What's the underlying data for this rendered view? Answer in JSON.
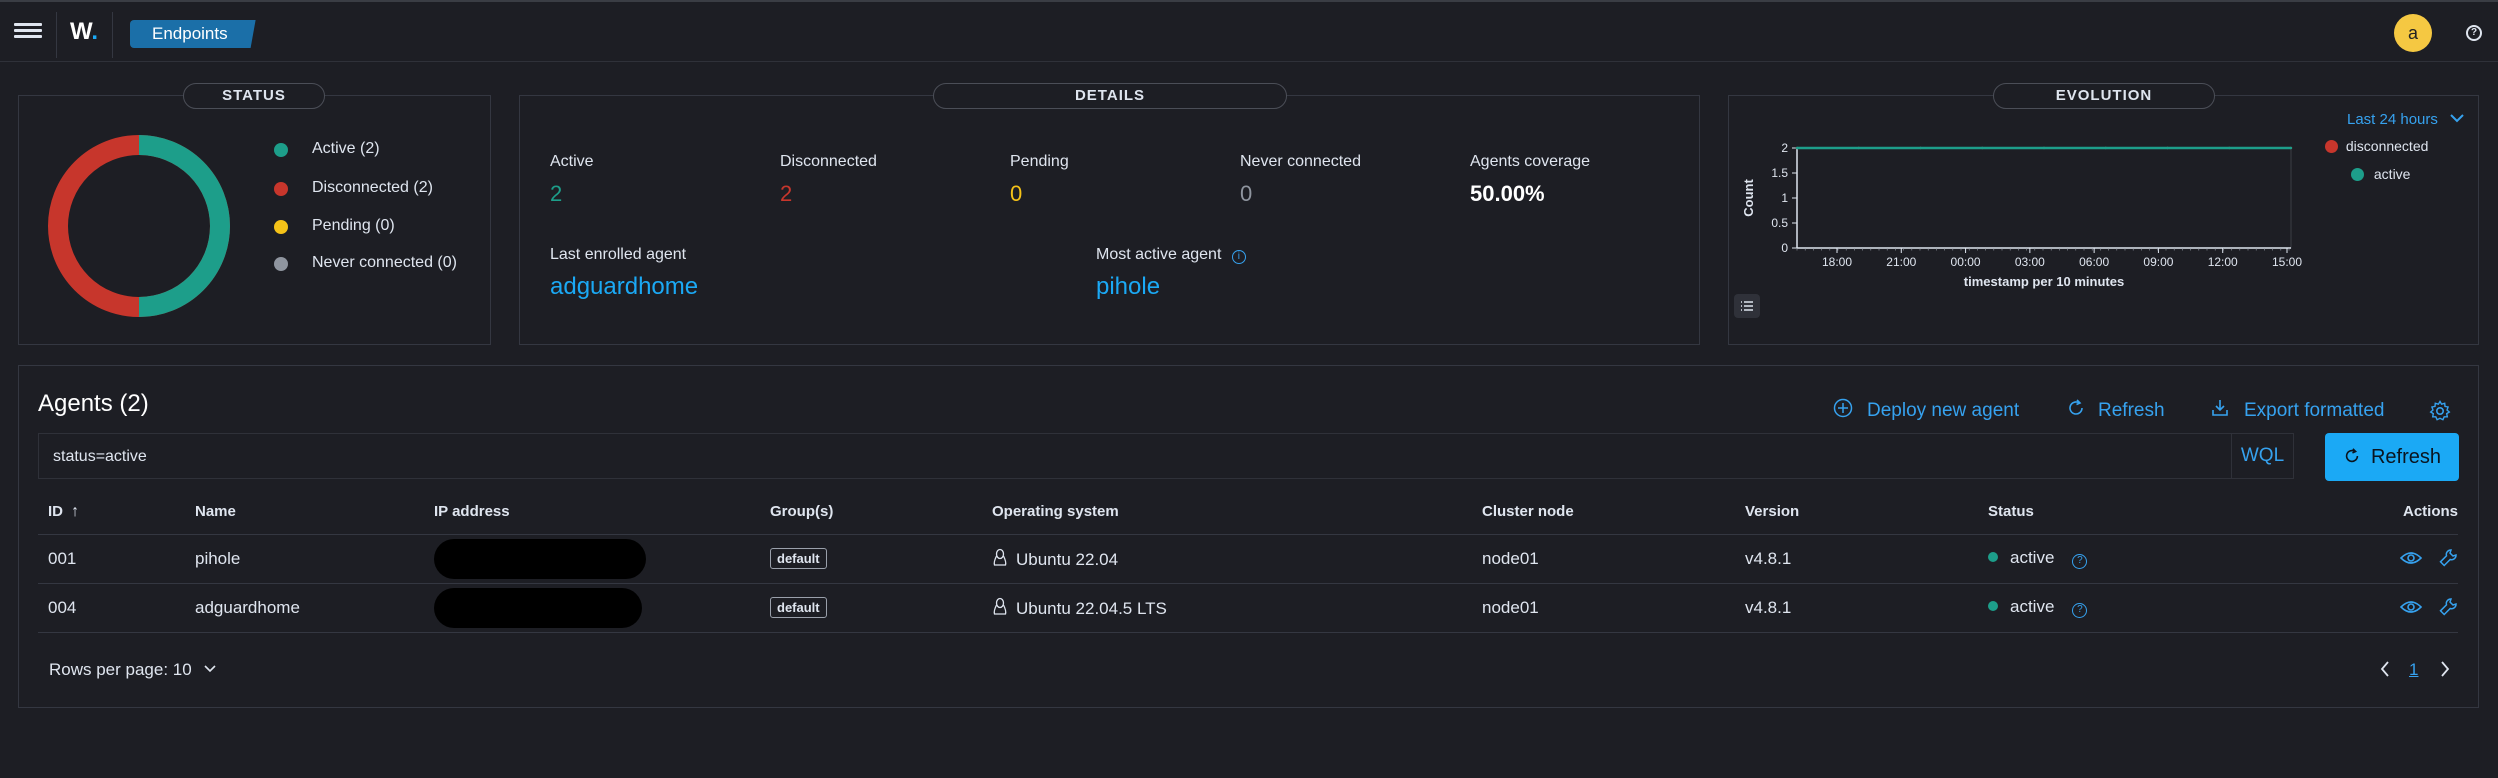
{
  "header": {
    "logo": "W",
    "breadcrumb": "Endpoints",
    "avatar_letter": "a",
    "help": "?"
  },
  "status_panel": {
    "title": "STATUS",
    "legend": [
      {
        "label": "Active (2)",
        "color": "#1d9e8a"
      },
      {
        "label": "Disconnected (2)",
        "color": "#c7362c"
      },
      {
        "label": "Pending (0)",
        "color": "#f5c218"
      },
      {
        "label": "Never connected (0)",
        "color": "#8f959f"
      }
    ]
  },
  "details_panel": {
    "title": "DETAILS",
    "stats": [
      {
        "label": "Active",
        "value": "2",
        "color": "#1d9e8a"
      },
      {
        "label": "Disconnected",
        "value": "2",
        "color": "#c7362c"
      },
      {
        "label": "Pending",
        "value": "0",
        "color": "#f5c218"
      },
      {
        "label": "Never connected",
        "value": "0",
        "color": "#8f959f"
      },
      {
        "label": "Agents coverage",
        "value": "50.00%",
        "color": "#ffffff"
      }
    ],
    "last_enrolled_label": "Last enrolled agent",
    "last_enrolled_value": "adguardhome",
    "most_active_label": "Most active agent",
    "most_active_value": "pihole",
    "info_icon": "i"
  },
  "evolution_panel": {
    "title": "EVOLUTION",
    "range_label": "Last 24 hours",
    "legend": [
      {
        "label": "disconnected",
        "color": "#c7362c"
      },
      {
        "label": "active",
        "color": "#1d9e8a"
      }
    ]
  },
  "chart_data": {
    "type": "line",
    "xlabel": "timestamp per 10 minutes",
    "ylabel": "Count",
    "x_ticks": [
      "18:00",
      "21:00",
      "00:00",
      "03:00",
      "06:00",
      "09:00",
      "12:00",
      "15:00"
    ],
    "y_ticks": [
      "0",
      "0.5",
      "1",
      "1.5",
      "2"
    ],
    "ylim": [
      0,
      2
    ],
    "series": [
      {
        "name": "disconnected",
        "values": [
          2,
          2,
          2,
          2,
          2,
          2,
          2,
          2,
          2
        ]
      },
      {
        "name": "active",
        "values": [
          2,
          2,
          2,
          2,
          2,
          2,
          2,
          2,
          2
        ]
      }
    ]
  },
  "agents": {
    "title": "Agents (2)",
    "actions": {
      "deploy": "Deploy new agent",
      "refresh": "Refresh",
      "export": "Export formatted"
    },
    "search_value": "status=active",
    "wql": "WQL",
    "refresh_button": "Refresh",
    "columns": [
      "ID",
      "Name",
      "IP address",
      "Group(s)",
      "Operating system",
      "Cluster node",
      "Version",
      "Status",
      "Actions"
    ],
    "sort_arrow": "↑",
    "rows": [
      {
        "id": "001",
        "name": "pihole",
        "group": "default",
        "os": "Ubuntu 22.04",
        "node": "node01",
        "version": "v4.8.1",
        "status": "active"
      },
      {
        "id": "004",
        "name": "adguardhome",
        "group": "default",
        "os": "Ubuntu 22.04.5 LTS",
        "node": "node01",
        "version": "v4.8.1",
        "status": "active"
      }
    ],
    "rows_per_page": "Rows per page: 10",
    "page": "1"
  }
}
